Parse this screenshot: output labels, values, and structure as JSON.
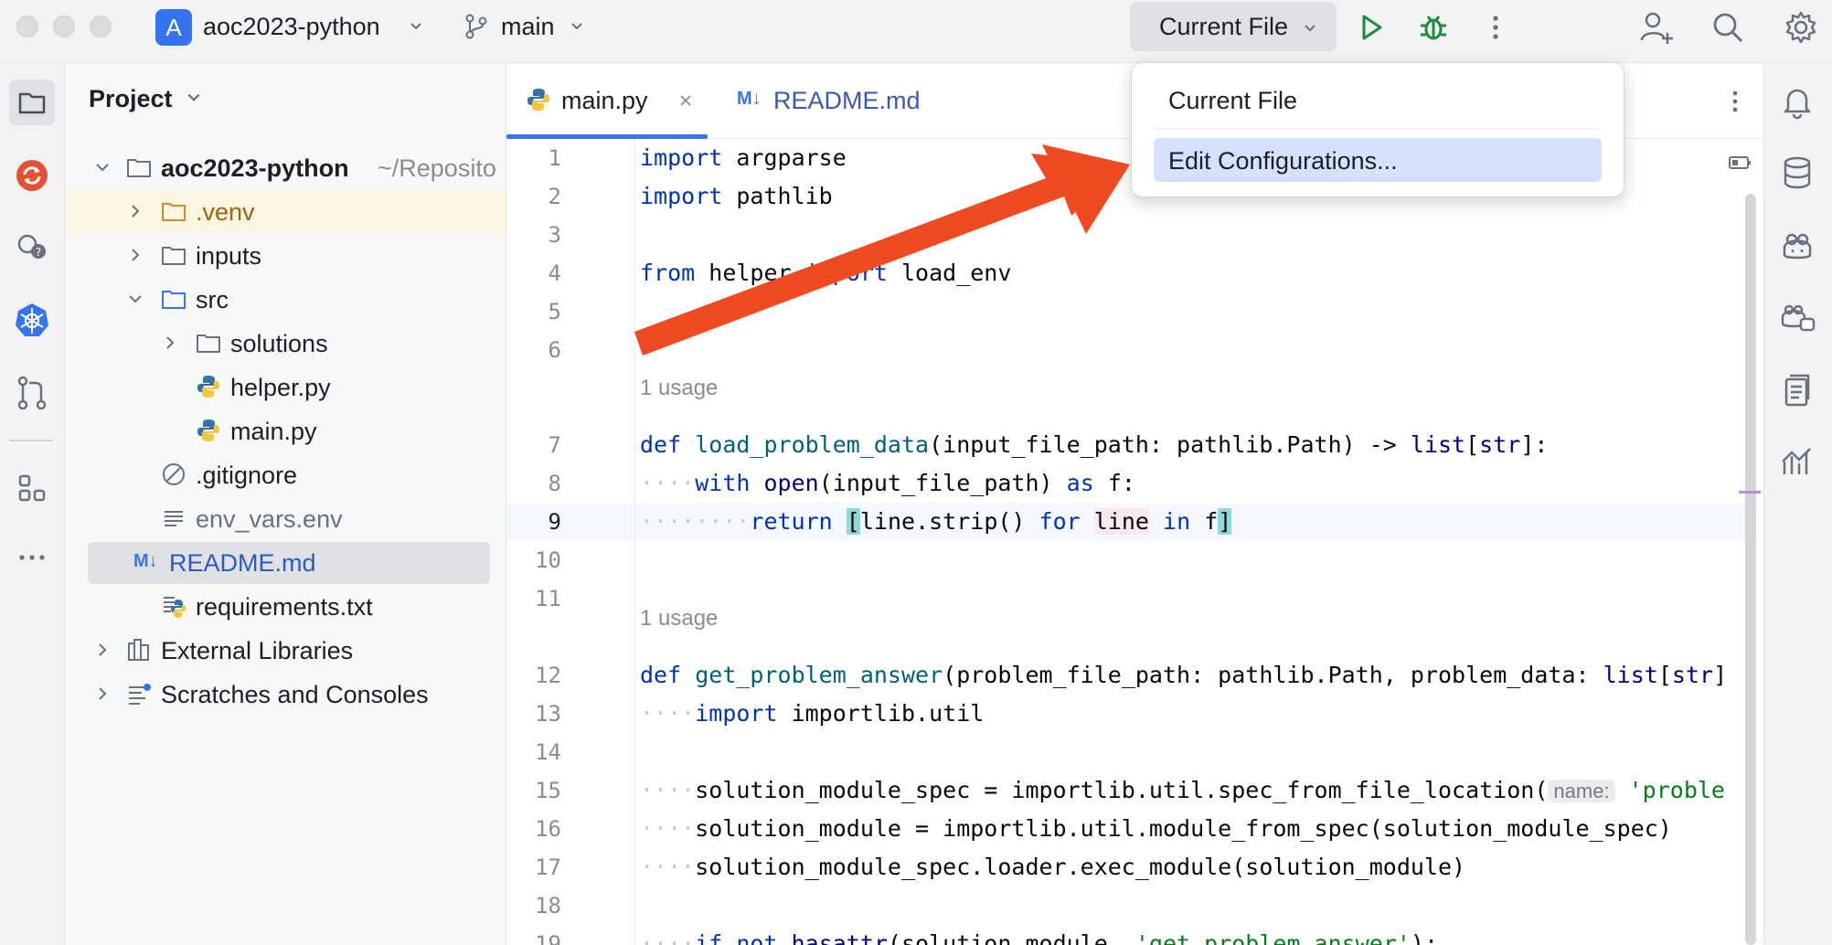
{
  "titlebar": {
    "project_badge": "A",
    "project_name": "aoc2023-python",
    "branch": "main",
    "run_config": "Current File",
    "icons": [
      "run-icon",
      "debug-icon",
      "more-vertical-icon",
      "add-user-icon",
      "search-icon",
      "settings-icon"
    ]
  },
  "left_strip": {
    "icons": [
      "folder-icon",
      "sync-icon",
      "ai-assistant-icon",
      "kubernetes-icon",
      "git-icon",
      "structure-icon",
      "more-horizontal-icon"
    ]
  },
  "project": {
    "title": "Project",
    "tree": [
      {
        "label": "aoc2023-python",
        "suffix": "~/Reposito",
        "icon": "folder-icon",
        "expanded": true
      },
      {
        "label": ".venv",
        "icon": "folder-icon",
        "expanded": false
      },
      {
        "label": "inputs",
        "icon": "folder-icon",
        "expanded": false
      },
      {
        "label": "src",
        "icon": "folder-icon",
        "expanded": true
      },
      {
        "label": "solutions",
        "icon": "folder-icon",
        "expanded": false
      },
      {
        "label": "helper.py",
        "icon": "python-file-icon"
      },
      {
        "label": "main.py",
        "icon": "python-file-icon"
      },
      {
        "label": ".gitignore",
        "icon": "ignore-file-icon"
      },
      {
        "label": "env_vars.env",
        "icon": "text-file-icon"
      },
      {
        "label": "README.md",
        "icon": "markdown-file-icon"
      },
      {
        "label": "requirements.txt",
        "icon": "requirements-file-icon"
      },
      {
        "label": "External Libraries",
        "icon": "libraries-icon"
      },
      {
        "label": "Scratches and Consoles",
        "icon": "scratches-icon"
      }
    ]
  },
  "editor": {
    "tabs": [
      {
        "label": "main.py",
        "active": true
      },
      {
        "label": "README.md",
        "active": false
      }
    ],
    "md_badge": "M↓",
    "usage_hint": "1 usage",
    "inlay_hint": "name:",
    "line_numbers": [
      "1",
      "2",
      "3",
      "4",
      "5",
      "6",
      "7",
      "8",
      "9",
      "10",
      "11",
      "12",
      "13",
      "14",
      "15",
      "16",
      "17",
      "18",
      "19"
    ]
  },
  "popup": {
    "items": [
      "Current File",
      "Edit Configurations..."
    ],
    "selected": "Edit Configurations..."
  },
  "colors": {
    "accent": "#3574f0",
    "keyword": "#0033b3",
    "function": "#00627a",
    "string": "#067d17",
    "annotation_arrow": "#f04a22",
    "selection": "#d4e2ff"
  }
}
